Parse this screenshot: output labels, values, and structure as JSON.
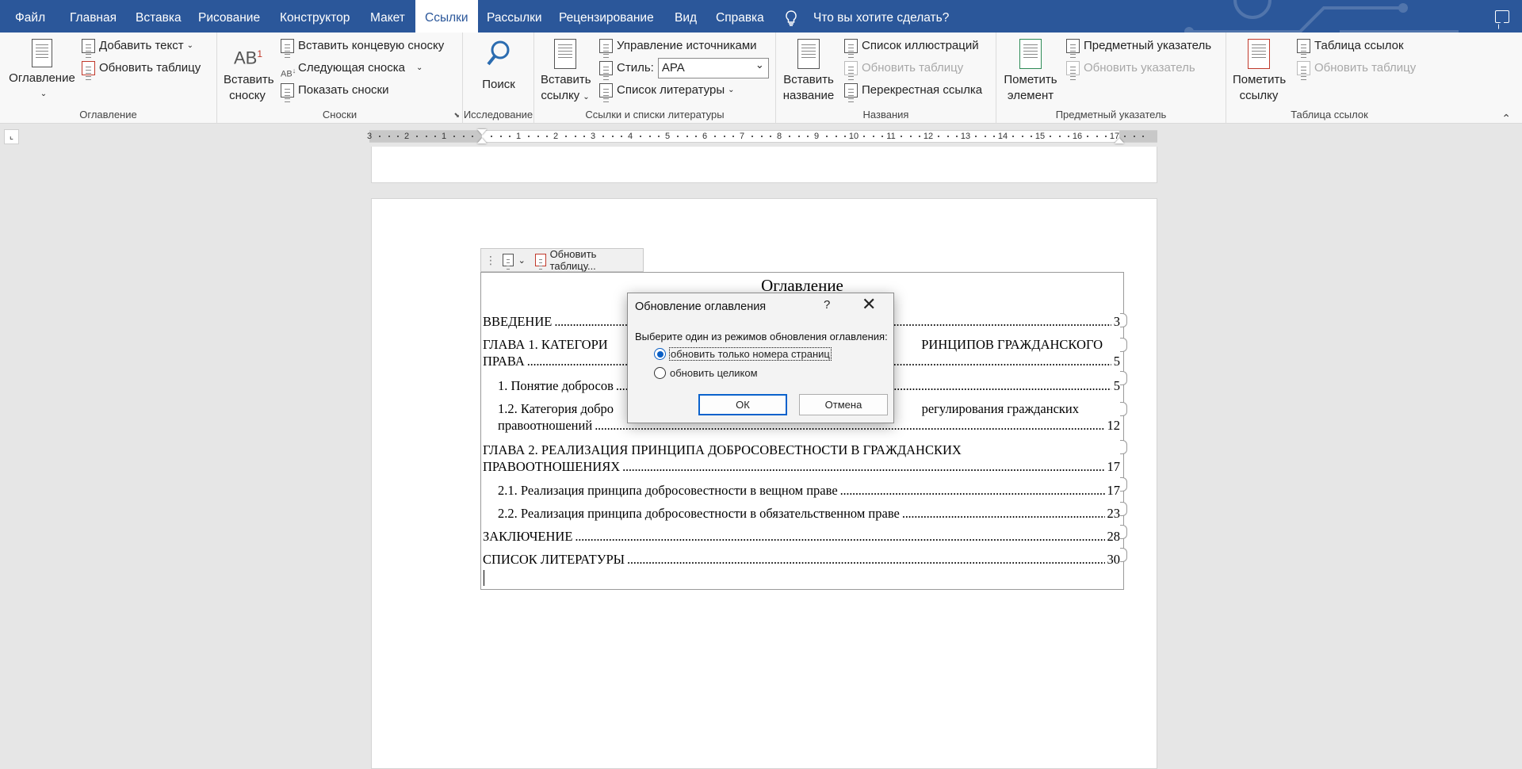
{
  "titlebar": {
    "tabs": [
      "Файл",
      "Главная",
      "Вставка",
      "Рисование",
      "Конструктор",
      "Макет",
      "Ссылки",
      "Рассылки",
      "Рецензирование",
      "Вид",
      "Справка"
    ],
    "active_tab": "Ссылки",
    "tell_me": "Что вы хотите сделать?",
    "accent": "#2b579a"
  },
  "ribbon": {
    "toc": {
      "big": "Оглавление",
      "add_text": "Добавить текст",
      "update_table": "Обновить таблицу",
      "label": "Оглавление"
    },
    "footnotes": {
      "big_line1": "Вставить",
      "big_line2": "сноску",
      "insert_endnote": "Вставить концевую сноску",
      "next_footnote": "Следующая сноска",
      "show_notes": "Показать сноски",
      "label": "Сноски"
    },
    "research": {
      "big": "Поиск",
      "label": "Исследование"
    },
    "citations": {
      "big_line1": "Вставить",
      "big_line2": "ссылку",
      "manage_sources": "Управление источниками",
      "style_label": "Стиль:",
      "style_value": "APA",
      "bibliography": "Список литературы",
      "label": "Ссылки и списки литературы"
    },
    "captions": {
      "big_line1": "Вставить",
      "big_line2": "название",
      "table_of_figures": "Список иллюстраций",
      "update_table": "Обновить таблицу",
      "cross_reference": "Перекрестная ссылка",
      "label": "Названия"
    },
    "index": {
      "big_line1": "Пометить",
      "big_line2": "элемент",
      "insert_index": "Предметный указатель",
      "update_index": "Обновить указатель",
      "label": "Предметный указатель"
    },
    "authorities": {
      "big_line1": "Пометить",
      "big_line2": "ссылку",
      "insert_table": "Таблица ссылок",
      "update_table": "Обновить таблицу",
      "label": "Таблица ссылок"
    }
  },
  "ruler": {
    "numbers": [
      "3",
      "2",
      "1",
      "",
      "1",
      "2",
      "3",
      "4",
      "5",
      "6",
      "7",
      "8",
      "9",
      "10",
      "11",
      "12",
      "13",
      "14",
      "15",
      "16",
      "17"
    ]
  },
  "toc_toolbar": {
    "update_label": "Обновить таблицу..."
  },
  "toc": {
    "title": "Оглавление",
    "entries": [
      {
        "line1": "ВВЕДЕНИЕ",
        "page": "3"
      },
      {
        "line1": "ГЛАВА 1. КАТЕГОРИ",
        "line1b": "РИНЦИПОВ ГРАЖДАНСКОГО",
        "line2": "ПРАВА",
        "page": "5"
      },
      {
        "line1": "1. Понятие добросов",
        "page": "5"
      },
      {
        "line1": "1.2. Категория добро",
        "line1b": "регулирования гражданских",
        "line2": "правоотношений",
        "page": "12"
      },
      {
        "line1": "ГЛАВА 2. РЕАЛИЗАЦИЯ ПРИНЦИПА ДОБРОСОВЕСТНОСТИ В ГРАЖДАНСКИХ",
        "line2": "ПРАВООТНОШЕНИЯХ",
        "page": "17"
      },
      {
        "line1": "2.1. Реализация принципа добросовестности в вещном праве",
        "page": "17"
      },
      {
        "line1": "2.2. Реализация принципа добросовестности в обязательственном праве",
        "page": "23"
      },
      {
        "line1": "ЗАКЛЮЧЕНИЕ",
        "page": "28"
      },
      {
        "line1": "СПИСОК ЛИТЕРАТУРЫ",
        "page": "30"
      }
    ]
  },
  "dialog": {
    "title": "Обновление оглавления",
    "help": "?",
    "prompt": "Выберите один из режимов обновления оглавления:",
    "option1": "обновить только номера страниц",
    "option2": "обновить целиком",
    "selected": "option1",
    "ok": "ОК",
    "cancel": "Отмена"
  }
}
